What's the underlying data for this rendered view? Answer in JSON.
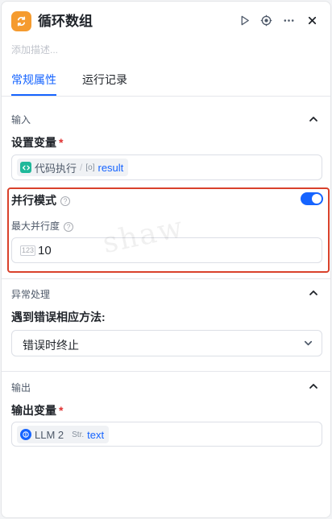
{
  "header": {
    "title": "循环数组",
    "description_placeholder": "添加描述...",
    "brand_color": "#f59b2f",
    "actions": [
      "play-icon",
      "target-icon",
      "more-icon",
      "close-icon"
    ]
  },
  "tabs": [
    {
      "label": "常规属性",
      "active": true
    },
    {
      "label": "运行记录",
      "active": false
    }
  ],
  "input_section": {
    "title": "输入",
    "set_variable": {
      "label": "设置变量",
      "required": "*",
      "source_node": "代码执行",
      "separator": "/",
      "type_icon": "[o]",
      "variable": "result"
    }
  },
  "parallel": {
    "label": "并行模式",
    "enabled": true,
    "max_parallel_label": "最大并行度",
    "max_parallel_value": "10",
    "number_icon": "123"
  },
  "error_section": {
    "title": "异常处理",
    "method_label": "遇到错误相应方法:",
    "selected": "错误时终止"
  },
  "output_section": {
    "title": "输出",
    "output_var": {
      "label": "输出变量",
      "required": "*",
      "source_node": "LLM 2",
      "type_label": "Str.",
      "variable": "text"
    }
  },
  "watermark": "shaw",
  "colors": {
    "accent": "#1664ff",
    "highlight_border": "#d9412b",
    "required": "#e03131"
  }
}
